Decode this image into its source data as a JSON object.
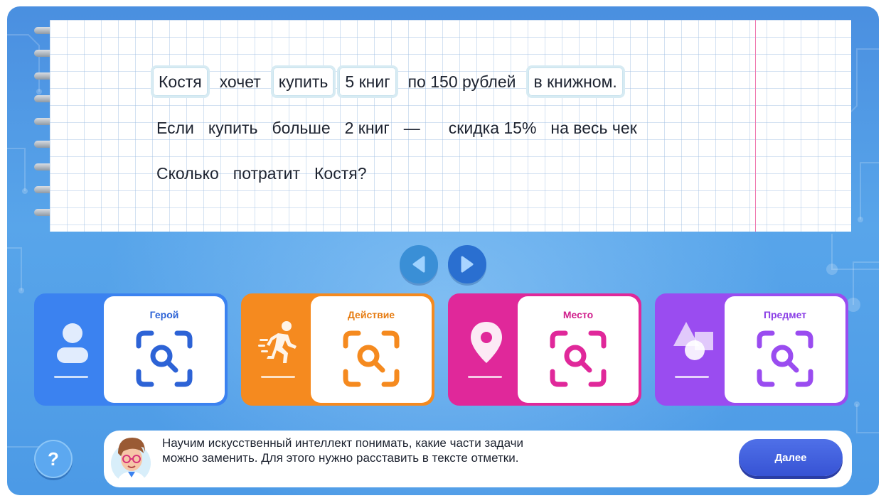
{
  "task": {
    "lines": [
      [
        {
          "text": "Костя",
          "marked": true
        },
        {
          "text": "хочет",
          "marked": false
        },
        {
          "text": "купить",
          "marked": true
        },
        {
          "text": "5 книг",
          "marked": true
        },
        {
          "text": "по 150 рублей",
          "marked": false
        },
        {
          "text": "в книжном.",
          "marked": true
        }
      ],
      [
        {
          "text": "Если",
          "marked": false
        },
        {
          "text": "купить",
          "marked": false
        },
        {
          "text": "больше",
          "marked": false
        },
        {
          "text": "2 книг",
          "marked": false
        },
        {
          "text": "—",
          "marked": false
        },
        {
          "text": "скидка 15%",
          "marked": false
        },
        {
          "text": "на весь чек",
          "marked": false
        }
      ],
      [
        {
          "text": "Сколько",
          "marked": false
        },
        {
          "text": "потратит",
          "marked": false
        },
        {
          "text": "Костя?",
          "marked": false
        }
      ]
    ]
  },
  "navigation": {
    "prev_icon": "triangle-left-icon",
    "next_icon": "triangle-right-icon"
  },
  "categories": [
    {
      "key": "hero",
      "label": "Герой",
      "icon": "person-icon",
      "color": "#3b82f0",
      "title_color": "#2d63d6"
    },
    {
      "key": "action",
      "label": "Действие",
      "icon": "running-man-icon",
      "color": "#f58a1f",
      "title_color": "#e67c12"
    },
    {
      "key": "place",
      "label": "Место",
      "icon": "location-pin-icon",
      "color": "#e0289a",
      "title_color": "#d01f8c"
    },
    {
      "key": "object",
      "label": "Предмет",
      "icon": "shapes-icon",
      "color": "#9a4cf0",
      "title_color": "#8a3ee6"
    }
  ],
  "help": {
    "label": "?"
  },
  "assistant": {
    "message": "Научим искусственный интеллект понимать, какие части задачи можно заменить. Для этого нужно расставить в тексте отметки.",
    "next_button": "Далее"
  }
}
